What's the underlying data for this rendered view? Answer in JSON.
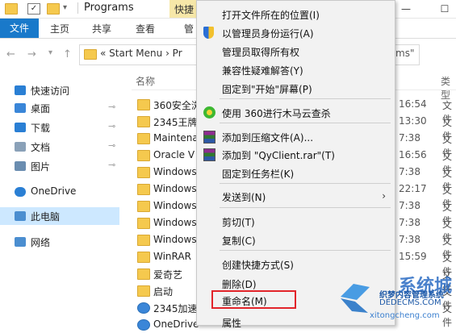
{
  "titlebar": {
    "title": "Programs",
    "tool_tab": "快捷",
    "minimize": "—",
    "maximize": "☐",
    "check_glyph": "✓"
  },
  "ribbon": {
    "tabs": [
      "文件",
      "主页",
      "共享",
      "查看",
      "管"
    ]
  },
  "address": {
    "back": "←",
    "forward": "→",
    "path_prefix": "«",
    "path_text": "Start Menu  ›  Pr",
    "search_tail": "ms\""
  },
  "nav": {
    "items": [
      {
        "label": "快速访问",
        "icon": "star-icon"
      },
      {
        "label": "桌面",
        "icon": "desktop-icon",
        "pinned": true
      },
      {
        "label": "下载",
        "icon": "download-icon",
        "pinned": true
      },
      {
        "label": "文档",
        "icon": "document-icon",
        "pinned": true
      },
      {
        "label": "图片",
        "icon": "picture-icon",
        "pinned": true
      },
      {
        "label": "OneDrive",
        "icon": "cloud-icon"
      },
      {
        "label": "此电脑",
        "icon": "computer-icon",
        "selected": true
      },
      {
        "label": "网络",
        "icon": "network-icon"
      }
    ],
    "pin_glyph": "📌"
  },
  "filelist": {
    "col_name": "名称",
    "col_type": "类型",
    "rows": [
      {
        "name": "360安全浏",
        "date": "16:54",
        "type": "文件"
      },
      {
        "name": "2345王牌",
        "date": "13:30",
        "type": "文件"
      },
      {
        "name": "Maintena",
        "date": "7:38",
        "type": "文件"
      },
      {
        "name": "Oracle V",
        "date": "16:56",
        "type": "文件"
      },
      {
        "name": "Windows",
        "date": "7:38",
        "type": "文件"
      },
      {
        "name": "Windows",
        "date": "22:17",
        "type": "文件"
      },
      {
        "name": "Windows",
        "date": "7:38",
        "type": "文件"
      },
      {
        "name": "Windows",
        "date": "7:38",
        "type": "文件"
      },
      {
        "name": "Windows",
        "date": "7:38",
        "type": "文件"
      },
      {
        "name": "WinRAR",
        "date": "15:59",
        "type": "文件"
      },
      {
        "name": "爱奇艺",
        "date": "",
        "type": "文件"
      },
      {
        "name": "启动",
        "date": "",
        "type": "文件"
      },
      {
        "name": "2345加速",
        "date": "",
        "type": "文件"
      },
      {
        "name": "OneDrive",
        "date": "",
        "type": ""
      }
    ]
  },
  "context_menu": {
    "items": [
      {
        "label": "打开文件所在的位置(I)",
        "icon": ""
      },
      {
        "label": "以管理员身份运行(A)",
        "icon": "shield-icon"
      },
      {
        "label": "管理员取得所有权",
        "icon": ""
      },
      {
        "label": "兼容性疑难解答(Y)",
        "icon": ""
      },
      {
        "label": "固定到\"开始\"屏幕(P)",
        "icon": ""
      },
      {
        "label": "使用 360进行木马云查杀",
        "icon": "360-icon"
      },
      {
        "label": "添加到压缩文件(A)...",
        "icon": "winrar-icon"
      },
      {
        "label": "添加到 \"QyClient.rar\"(T)",
        "icon": "winrar-icon"
      },
      {
        "label": "固定到任务栏(K)",
        "icon": ""
      },
      {
        "label": "发送到(N)",
        "icon": "",
        "submenu": true
      },
      {
        "label": "剪切(T)",
        "icon": ""
      },
      {
        "label": "复制(C)",
        "icon": ""
      },
      {
        "label": "创建快捷方式(S)",
        "icon": ""
      },
      {
        "label": "删除(D)",
        "icon": ""
      },
      {
        "label": "重命名(M)",
        "icon": "",
        "highlighted": true
      },
      {
        "label": "属性",
        "icon": ""
      }
    ],
    "submenu_arrow": "›",
    "highlight_color": "#e2242a"
  },
  "watermark": {
    "big": "系统城",
    "line1": "织梦内容管理系统",
    "line2": "DEDECMS.COM",
    "line3": "xitongcheng.com"
  },
  "colors": {
    "accent": "#1979ca",
    "selection": "#cde8ff",
    "folder": "#f5c94e"
  }
}
